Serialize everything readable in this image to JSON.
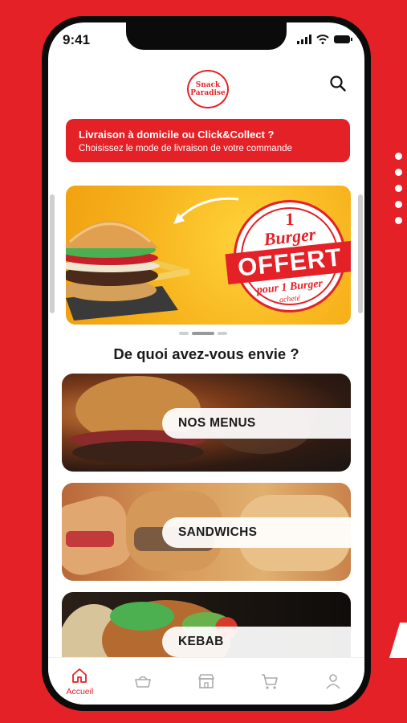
{
  "status_bar": {
    "time": "9:41"
  },
  "header": {
    "logo_line1": "Snack",
    "logo_line2": "Paradise",
    "search_icon": "search-icon"
  },
  "delivery_banner": {
    "title": "Livraison à domicile ou Click&Collect ?",
    "subtitle": "Choisissez le mode de livraison de votre commande"
  },
  "promo": {
    "number": "1",
    "word": "Burger",
    "headline": "OFFERT",
    "condition": "pour 1 Burger",
    "condition_suffix": "acheté"
  },
  "section_title": "De quoi avez-vous envie ?",
  "categories": [
    {
      "label": "NOS MENUS"
    },
    {
      "label": "SANDWICHS"
    },
    {
      "label": "KEBAB"
    }
  ],
  "bottom_nav": {
    "items": [
      {
        "icon": "home-icon",
        "label": "Accueil",
        "active": true
      },
      {
        "icon": "basket-icon",
        "label": ""
      },
      {
        "icon": "store-icon",
        "label": ""
      },
      {
        "icon": "cart-icon",
        "label": ""
      },
      {
        "icon": "user-icon",
        "label": ""
      }
    ]
  },
  "colors": {
    "brand_red": "#e42127",
    "promo_yellow": "#f7b21c"
  }
}
